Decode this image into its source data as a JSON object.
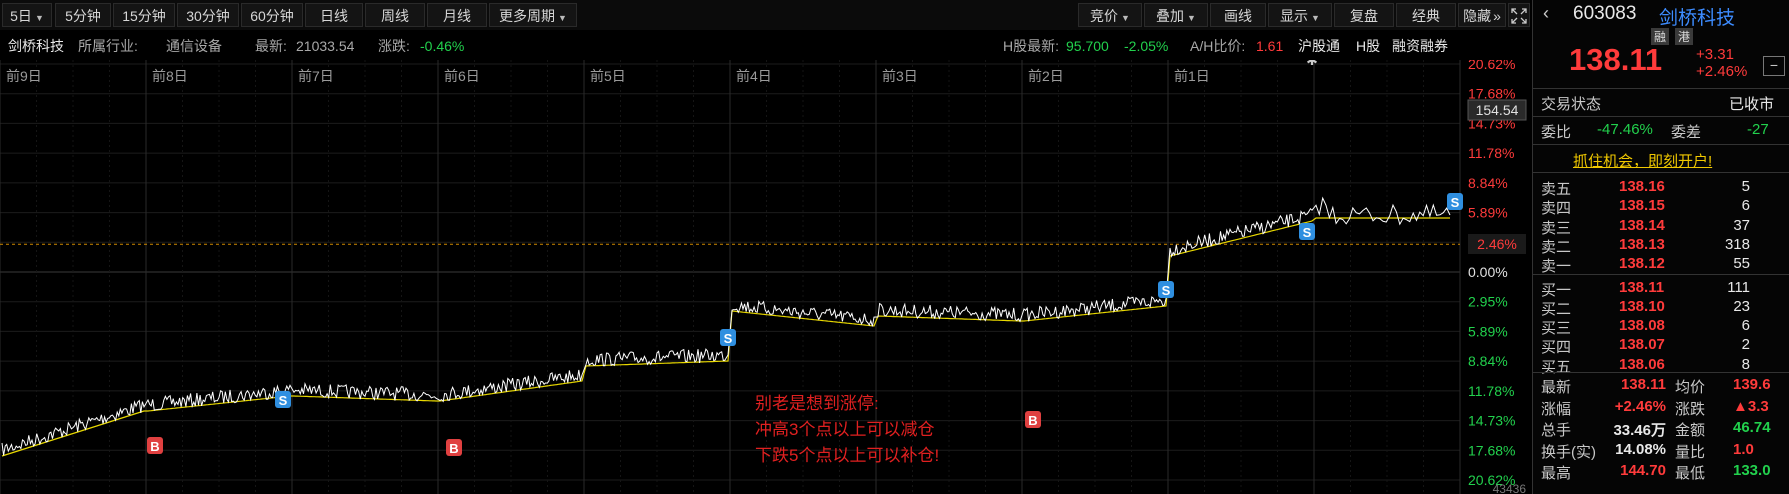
{
  "toolbar": {
    "period_5d": "5日",
    "periods": [
      "5分钟",
      "15分钟",
      "30分钟",
      "60分钟",
      "日线",
      "周线",
      "月线"
    ],
    "more_periods": "更多周期",
    "right": [
      {
        "label": "竞价",
        "dropdown": true
      },
      {
        "label": "叠加",
        "dropdown": true
      },
      {
        "label": "画线",
        "dropdown": false
      },
      {
        "label": "显示",
        "dropdown": true
      },
      {
        "label": "复盘",
        "dropdown": false
      },
      {
        "label": "经典",
        "dropdown": false
      },
      {
        "label": "隐藏",
        "dropdown": false
      }
    ],
    "hide_arrow": "»"
  },
  "info": {
    "stock_name": "剑桥科技",
    "industry_label": "所属行业:",
    "industry": "通信设备",
    "latest_label": "最新:",
    "latest": "21033.54",
    "change_label": "涨跌:",
    "change": "-0.46%",
    "h_latest_label": "H股最新:",
    "h_latest": "95.700",
    "h_change": "-2.05%",
    "ah_label": "A/H比价:",
    "ah_ratio": "1.61",
    "links": [
      "沪股通",
      "H股",
      "融资融券"
    ]
  },
  "chart": {
    "day_labels": [
      "前9日",
      "前8日",
      "前7日",
      "前6日",
      "前5日",
      "前4日",
      "前3日",
      "前2日",
      "前1日"
    ],
    "right_axis": [
      "20.62%",
      "17.68%",
      "14.73%",
      "11.78%",
      "8.84%",
      "5.89%",
      "2.46%",
      "0.00%",
      "2.95%",
      "5.89%",
      "8.84%",
      "11.78%",
      "14.73%",
      "17.68%",
      "20.62%"
    ],
    "price_tag": "154.54",
    "current_pct": "2.46%",
    "bottom_label": "43436",
    "annotation": [
      "别老是想到涨停:",
      "冲高3个点以上可以减仓",
      "下跌5个点以上可以补仓!"
    ],
    "colors": {
      "price": "#ffffff",
      "avg": "#e8d800",
      "buy": "#e04040",
      "sell": "#2f8fe0",
      "dashed": "#d08a00"
    }
  },
  "panel": {
    "code": "603083",
    "name": "剑桥科技",
    "badges": [
      "融",
      "港"
    ],
    "price": "138.11",
    "change": "+3.31",
    "change_pct": "+2.46%",
    "trade_status_label": "交易状态",
    "trade_status": "已收市",
    "wb_label": "委比",
    "wb": "-47.46%",
    "wc_label": "委差",
    "wc": "-27",
    "promo": "抓住机会，即刻开户!",
    "asks": [
      {
        "label": "卖五",
        "price": "138.16",
        "vol": "5"
      },
      {
        "label": "卖四",
        "price": "138.15",
        "vol": "6"
      },
      {
        "label": "卖三",
        "price": "138.14",
        "vol": "37"
      },
      {
        "label": "卖二",
        "price": "138.13",
        "vol": "318"
      },
      {
        "label": "卖一",
        "price": "138.12",
        "vol": "55"
      }
    ],
    "bids": [
      {
        "label": "买一",
        "price": "138.11",
        "vol": "111"
      },
      {
        "label": "买二",
        "price": "138.10",
        "vol": "23"
      },
      {
        "label": "买三",
        "price": "138.08",
        "vol": "6"
      },
      {
        "label": "买四",
        "price": "138.07",
        "vol": "2"
      },
      {
        "label": "买五",
        "price": "138.06",
        "vol": "8"
      }
    ],
    "stats": [
      {
        "l1": "最新",
        "v1": "138.11",
        "l2": "均价",
        "v2": "139.6"
      },
      {
        "l1": "涨幅",
        "v1": "+2.46%",
        "l2": "涨跌",
        "v2": "▲3.3"
      },
      {
        "l1": "总手",
        "v1": "33.46万",
        "l2": "金额",
        "v2": "46.74"
      },
      {
        "l1": "换手(实)",
        "v1": "14.08%",
        "l2": "量比",
        "v2": "1.0"
      },
      {
        "l1": "最高",
        "v1": "144.70",
        "l2": "最低",
        "v2": "133.0"
      }
    ]
  }
}
